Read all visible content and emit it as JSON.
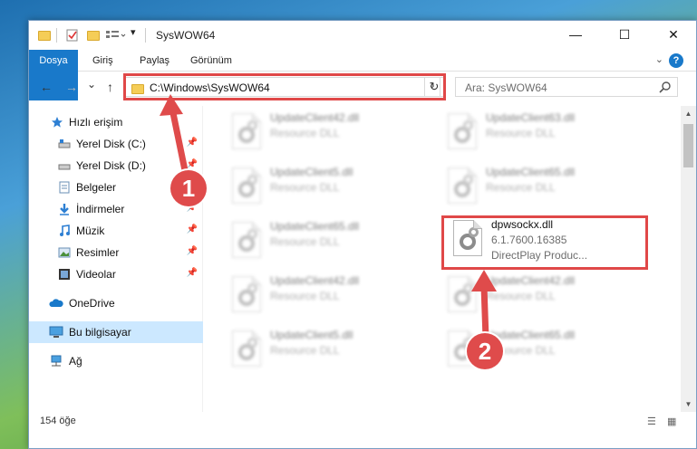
{
  "window": {
    "title": "SysWOW64",
    "minimize": "—",
    "maximize": "☐",
    "close": "✕"
  },
  "ribbon": {
    "tabs": [
      "Dosya",
      "Giriş",
      "Paylaş",
      "Görünüm"
    ],
    "help": "?"
  },
  "navigation": {
    "back": "←",
    "forward": "→",
    "recent": "⌄",
    "up": "↑",
    "address": "C:\\Windows\\SysWOW64",
    "refresh": "↻",
    "search_placeholder": "Ara: SysWOW64"
  },
  "sidebar": {
    "items": [
      {
        "label": "Hızlı erişim",
        "icon": "star-icon"
      },
      {
        "label": "Yerel Disk (C:)",
        "icon": "drive-icon",
        "pinned": true
      },
      {
        "label": "Yerel Disk (D:)",
        "icon": "drive-icon",
        "pinned": true
      },
      {
        "label": "Belgeler",
        "icon": "documents-icon",
        "pinned": true
      },
      {
        "label": "İndirmeler",
        "icon": "downloads-icon",
        "pinned": true
      },
      {
        "label": "Müzik",
        "icon": "music-icon",
        "pinned": true
      },
      {
        "label": "Resimler",
        "icon": "pictures-icon",
        "pinned": true
      },
      {
        "label": "Videolar",
        "icon": "videos-icon",
        "pinned": true
      },
      {
        "label": "OneDrive",
        "icon": "cloud-icon"
      },
      {
        "label": "Bu bilgisayar",
        "icon": "computer-icon",
        "selected": true
      },
      {
        "label": "Ağ",
        "icon": "network-icon"
      }
    ]
  },
  "files": {
    "left": [
      {
        "name": "UpdateClient42.dll",
        "desc": "Resource DLL"
      },
      {
        "name": "UpdateClient5.dll",
        "desc": "Resource DLL"
      },
      {
        "name": "UpdateClient65.dll",
        "desc": "Resource DLL"
      },
      {
        "name": "UpdateClient42.dll",
        "desc": "Resource DLL"
      },
      {
        "name": "UpdateClient5.dll",
        "desc": "Resource DLL"
      }
    ],
    "right": [
      {
        "name": "UpdateClient63.dll",
        "desc": "Resource DLL"
      },
      {
        "name": "UpdateClient65.dll",
        "desc": "Resource DLL"
      },
      {
        "name": "UpdateClient42.dll",
        "desc": "Resource DLL"
      },
      {
        "name": "UpdateClient65.dll",
        "desc": "Resource DLL"
      }
    ],
    "highlighted": {
      "name": "dpwsockx.dll",
      "version": "6.1.7600.16385",
      "description": "DirectPlay    Produc..."
    }
  },
  "status": {
    "count": "154 öğe"
  },
  "callouts": {
    "one": "1",
    "two": "2"
  },
  "colors": {
    "accent": "#1979ca",
    "highlight": "#e04848",
    "callout": "#df4b4b"
  }
}
